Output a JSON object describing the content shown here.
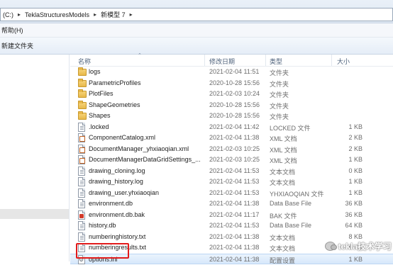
{
  "address": {
    "segments": [
      "(C:)",
      "TeklaStructuresModels",
      "新模型 7"
    ]
  },
  "menu": {
    "help": "帮助(H)"
  },
  "toolbar": {
    "new_folder": "新建文件夹"
  },
  "columns": {
    "name": "名称",
    "date": "修改日期",
    "type": "类型",
    "size": "大小"
  },
  "files": [
    {
      "name": "logs",
      "date": "2021-02-04 11:51",
      "type": "文件夹",
      "size": "",
      "icon": "folder-icon"
    },
    {
      "name": "ParametricProfiles",
      "date": "2020-10-28 15:56",
      "type": "文件夹",
      "size": "",
      "icon": "folder-icon"
    },
    {
      "name": "PlotFiles",
      "date": "2021-02-03 10:24",
      "type": "文件夹",
      "size": "",
      "icon": "folder-icon"
    },
    {
      "name": "ShapeGeometries",
      "date": "2020-10-28 15:56",
      "type": "文件夹",
      "size": "",
      "icon": "folder-icon"
    },
    {
      "name": "Shapes",
      "date": "2020-10-28 15:56",
      "type": "文件夹",
      "size": "",
      "icon": "folder-icon"
    },
    {
      "name": ".locked",
      "date": "2021-02-04 11:42",
      "type": "LOCKED 文件",
      "size": "1 KB",
      "icon": "file-icon"
    },
    {
      "name": "ComponentCatalog.xml",
      "date": "2021-02-04 11:38",
      "type": "XML 文档",
      "size": "2 KB",
      "icon": "xml-file-icon"
    },
    {
      "name": "DocumentManager_yhxiaoqian.xml",
      "date": "2021-02-03 10:25",
      "type": "XML 文档",
      "size": "2 KB",
      "icon": "xml-file-icon"
    },
    {
      "name": "DocumentManagerDataGridSettings_...",
      "date": "2021-02-03 10:25",
      "type": "XML 文档",
      "size": "1 KB",
      "icon": "xml-file-icon"
    },
    {
      "name": "drawing_cloning.log",
      "date": "2021-02-04 11:53",
      "type": "文本文档",
      "size": "0 KB",
      "icon": "text-file-icon"
    },
    {
      "name": "drawing_history.log",
      "date": "2021-02-04 11:53",
      "type": "文本文档",
      "size": "1 KB",
      "icon": "text-file-icon"
    },
    {
      "name": "drawing_user.yhxiaoqian",
      "date": "2021-02-04 11:53",
      "type": "YHXIAOQIAN 文件",
      "size": "1 KB",
      "icon": "file-icon"
    },
    {
      "name": "environment.db",
      "date": "2021-02-04 11:38",
      "type": "Data Base File",
      "size": "36 KB",
      "icon": "db-file-icon"
    },
    {
      "name": "environment.db.bak",
      "date": "2021-02-04 11:17",
      "type": "BAK 文件",
      "size": "36 KB",
      "icon": "bak-file-icon"
    },
    {
      "name": "history.db",
      "date": "2021-02-04 11:53",
      "type": "Data Base File",
      "size": "64 KB",
      "icon": "db-file-icon"
    },
    {
      "name": "numberinghistory.txt",
      "date": "2021-02-04 11:38",
      "type": "文本文档",
      "size": "8 KB",
      "icon": "text-file-icon"
    },
    {
      "name": "numberingresults.txt",
      "date": "2021-02-04 11:38",
      "type": "文本文档",
      "size": "5 KB",
      "icon": "text-file-icon"
    },
    {
      "name": "options.ini",
      "date": "2021-02-04 11:38",
      "type": "配置设置",
      "size": "1 KB",
      "icon": "ini-file-icon"
    }
  ],
  "watermark": {
    "text": "tekla技术学习"
  },
  "colors": {
    "highlight_box": "#e21b1b",
    "row_hover": "#d7e8fb"
  }
}
